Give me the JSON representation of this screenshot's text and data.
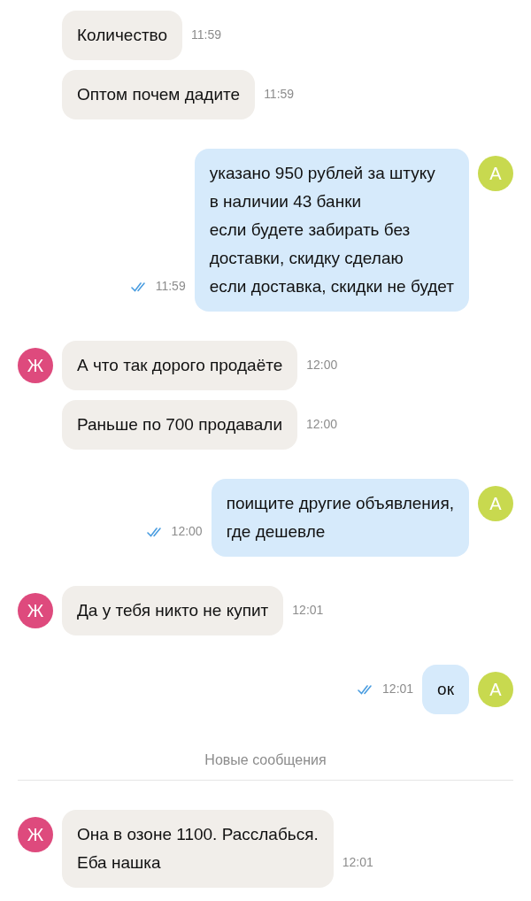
{
  "items": [
    {
      "kind": "incoming",
      "text": "Количество",
      "time": "11:59"
    },
    {
      "kind": "incoming",
      "text": "Оптом почем дадите",
      "time": "11:59"
    },
    {
      "kind": "outgoing",
      "avatar": {
        "letter": "А",
        "color": "#c8d94f"
      },
      "text": "указано 950 рублей за штуку\nв наличии 43 банки\nесли будете забирать без\nдоставки, скидку сделаю\nесли доставка, скидки не будет",
      "time": "11:59",
      "read": true
    },
    {
      "kind": "incoming",
      "avatar": {
        "letter": "Ж",
        "color": "#de4a7d"
      },
      "text": "А что так дорого продаёте",
      "time": "12:00"
    },
    {
      "kind": "incoming",
      "text": "Раньше по 700 продавали",
      "time": "12:00"
    },
    {
      "kind": "outgoing",
      "avatar": {
        "letter": "А",
        "color": "#c8d94f"
      },
      "text": "поищите другие объявления,\nгде дешевле",
      "time": "12:00",
      "read": true
    },
    {
      "kind": "incoming",
      "avatar": {
        "letter": "Ж",
        "color": "#de4a7d"
      },
      "text": "Да у тебя никто не купит",
      "time": "12:01"
    },
    {
      "kind": "outgoing",
      "avatar": {
        "letter": "А",
        "color": "#c8d94f"
      },
      "text": "ок",
      "time": "12:01",
      "read": true
    },
    {
      "kind": "divider",
      "text": "Новые сообщения"
    },
    {
      "kind": "incoming",
      "avatar": {
        "letter": "Ж",
        "color": "#de4a7d"
      },
      "text": "Она в озоне 1100. Расслабься.\nЕба нашка",
      "time": "12:01"
    }
  ]
}
